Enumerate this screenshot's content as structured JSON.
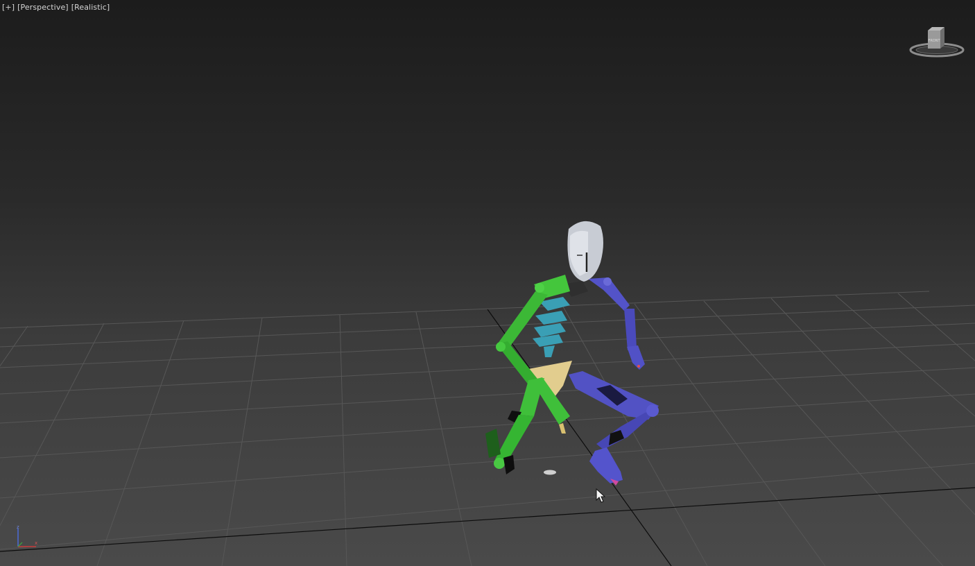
{
  "viewport": {
    "plus_menu": "[+]",
    "view_menu": "[Perspective]",
    "shading_menu": "[Realistic]"
  },
  "viewcube": {
    "face_label": "FRONT",
    "icon": "viewcube-icon"
  },
  "axis_tripod": {
    "z_label": "z",
    "x_label": "x"
  },
  "colors": {
    "grid": "#5a5a5a",
    "grid_axis": "#0a0a0a",
    "biped_left": "#3fbf3a",
    "biped_right": "#5353c8",
    "spine": "#3aa0b8",
    "pelvis": "#e3cf8f",
    "head": "#c9ccd4"
  },
  "cursor": {
    "icon": "mouse-pointer-icon"
  }
}
